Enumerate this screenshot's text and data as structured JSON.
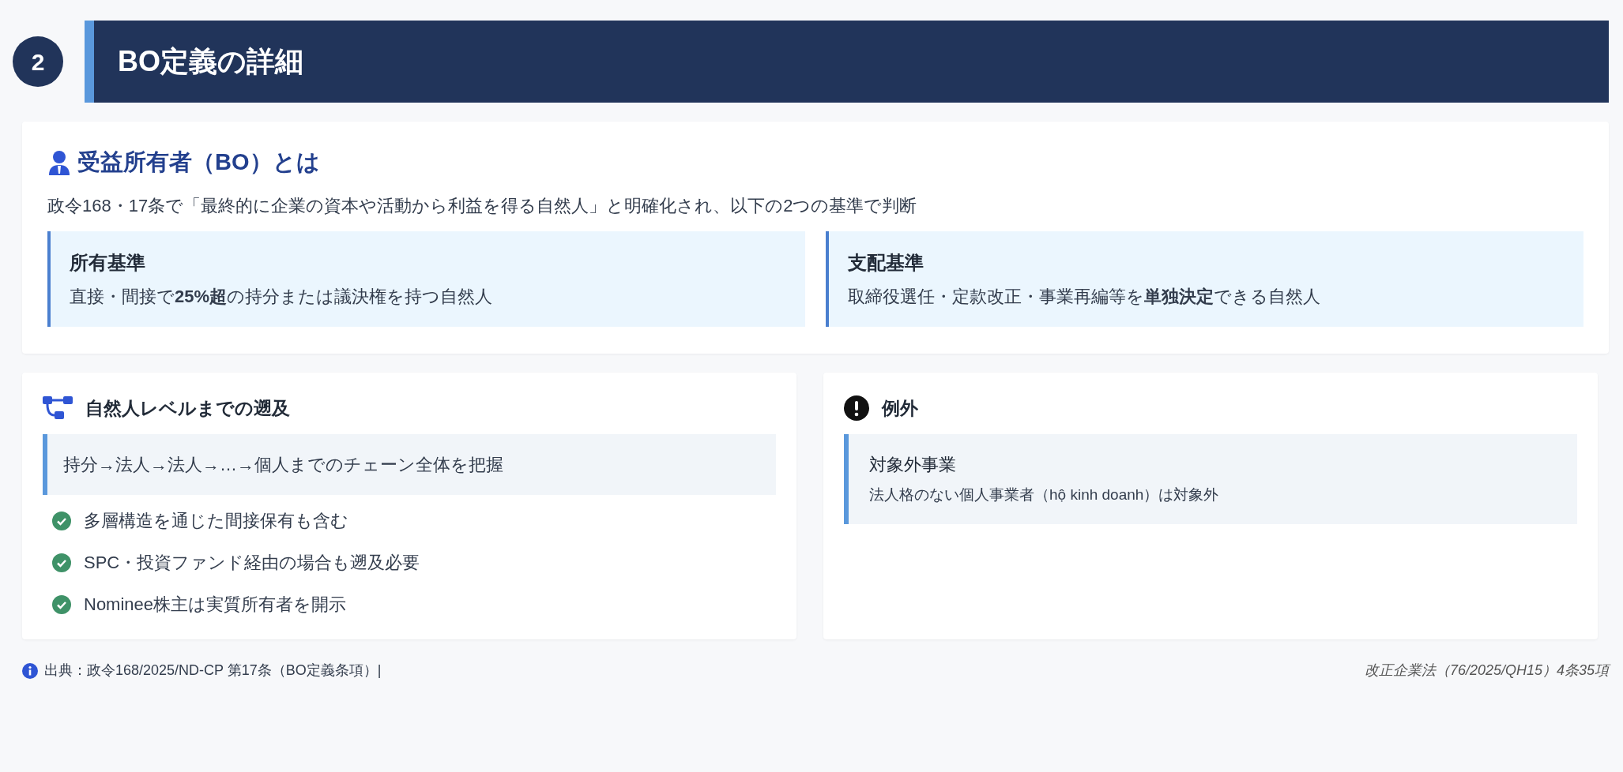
{
  "section": {
    "number": "2",
    "title": "BO定義の詳細"
  },
  "definition": {
    "title": "受益所有者（BO）とは",
    "lead": "政令168・17条で「最終的に企業の資本や活動から利益を得る自然人」と明確化され、以下の2つの基準で判断",
    "criteria": [
      {
        "title": "所有基準",
        "text": "直接・間接で**25%超**の持分または議決権を持つ自然人"
      },
      {
        "title": "支配基準",
        "text": "取締役選任・定款改正・事業再編等を**単独決定**できる自然人"
      }
    ]
  },
  "tracing": {
    "title": "自然人レベルまでの遡及",
    "chain": "持分→法人→法人→…→個人までのチェーン全体を把握",
    "points": [
      {
        "text": "多層構造を通じた間接保有も含む",
        "checked": true
      },
      {
        "text": "SPC・投資ファンド経由の場合も遡及必要",
        "checked": true
      },
      {
        "text": "Nominee株主は実質所有者を開示",
        "checked": true
      }
    ]
  },
  "exceptions": {
    "title": "例外",
    "items": [
      {
        "title": "対象外事業",
        "text": "法人格のない個人事業者（hộ kinh doanh）は対象外"
      }
    ]
  },
  "footer": {
    "source": "出典：政令168/2025/ND-CP 第17条（BO定義条項）|",
    "reference": "改正企業法（76/2025/QH15）4条35項"
  }
}
